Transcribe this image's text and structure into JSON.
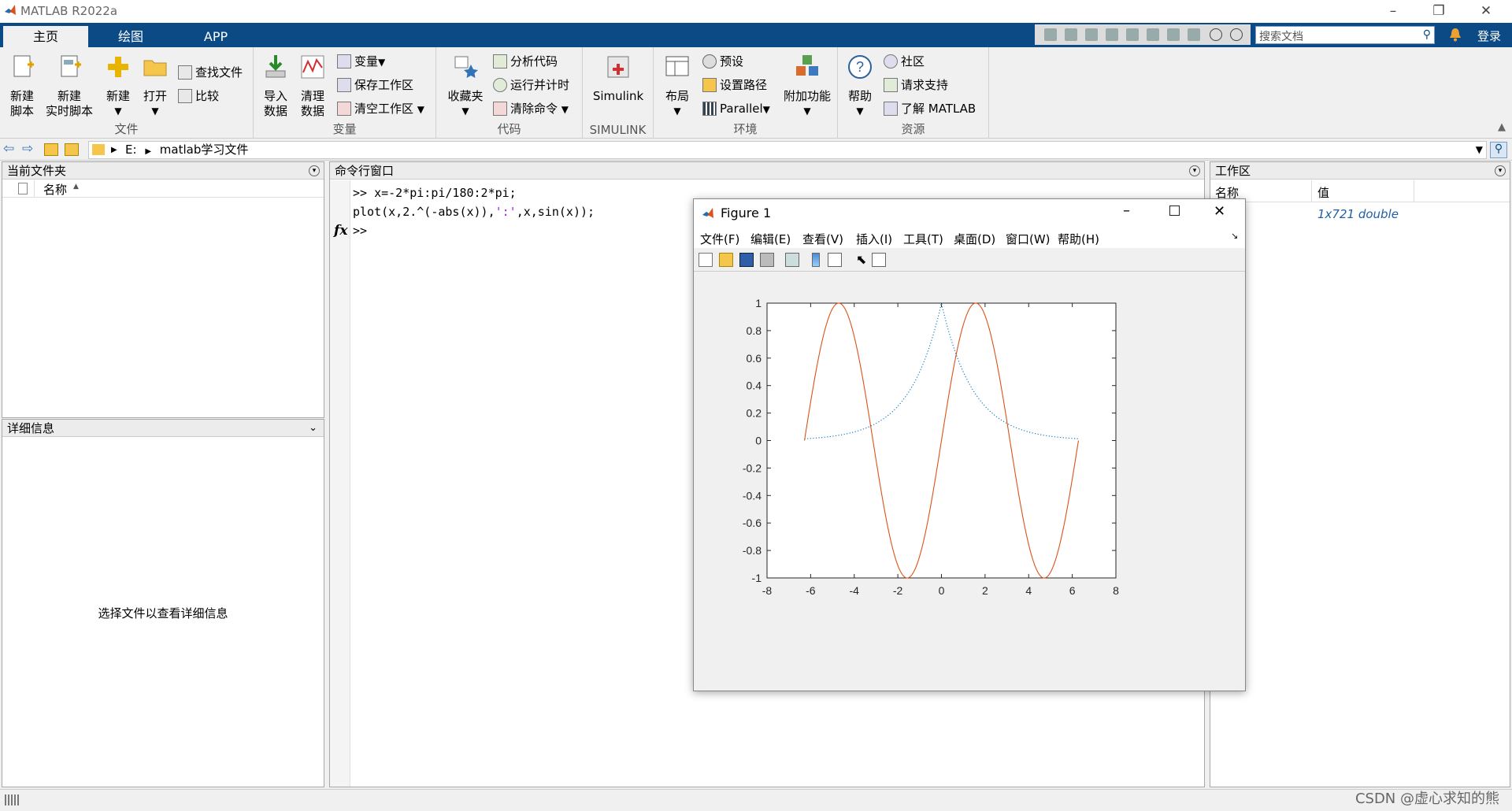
{
  "window": {
    "title": "MATLAB R2022a"
  },
  "tabs": [
    "主页",
    "绘图",
    "APP"
  ],
  "search": {
    "placeholder": "搜索文档"
  },
  "login": "登录",
  "ribbon": {
    "file": {
      "label": "文件",
      "new_script": [
        "新建",
        "脚本"
      ],
      "new_live_script": [
        "新建",
        "实时脚本"
      ],
      "new": "新建",
      "open": "打开",
      "find_files": "查找文件",
      "compare": "比较"
    },
    "variable": {
      "label": "变量",
      "import": [
        "导入",
        "数据"
      ],
      "clean": [
        "清理",
        "数据"
      ],
      "variable": "变量",
      "save_ws": "保存工作区",
      "clear_ws": "清空工作区"
    },
    "code": {
      "label": "代码",
      "favorites": "收藏夹",
      "analyze": "分析代码",
      "run_time": "运行并计时",
      "clear_cmd": "清除命令"
    },
    "simulink": {
      "label": "SIMULINK",
      "btn": "Simulink"
    },
    "env": {
      "label": "环境",
      "layout": "布局",
      "prefs": "预设",
      "set_path": "设置路径",
      "parallel": "Parallel",
      "addons": "附加功能"
    },
    "resources": {
      "label": "资源",
      "help": "帮助",
      "community": "社区",
      "request_support": "请求支持",
      "learn_matlab": "了解 MATLAB"
    }
  },
  "address": {
    "drive": "E:",
    "folder": "matlab学习文件"
  },
  "current_folder": {
    "title": "当前文件夹",
    "col_name": "名称"
  },
  "details": {
    "title": "详细信息",
    "message": "选择文件以查看详细信息"
  },
  "command_window": {
    "title": "命令行窗口",
    "line1": ">> x=-2*pi:pi/180:2*pi;",
    "line2_a": "plot(x,2.^(-abs(x)),",
    "line2_str": "':'",
    "line2_b": ",x,sin(x));",
    "fx": "fx",
    "prompt": ">>"
  },
  "workspace": {
    "title": "工作区",
    "col_name": "名称",
    "col_value": "值",
    "row_value": "1x721 double"
  },
  "figure": {
    "title": "Figure 1",
    "menu": [
      "文件(F)",
      "编辑(E)",
      "查看(V)",
      "插入(I)",
      "工具(T)",
      "桌面(D)",
      "窗口(W)",
      "帮助(H)"
    ]
  },
  "chart_data": {
    "type": "line",
    "xlim": [
      -8,
      8
    ],
    "ylim": [
      -1,
      1
    ],
    "xticks": [
      "-8",
      "-6",
      "-4",
      "-2",
      "0",
      "2",
      "4",
      "6",
      "8"
    ],
    "yticks": [
      "1",
      "0.8",
      "0.6",
      "0.4",
      "0.2",
      "0",
      "-0.2",
      "-0.4",
      "-0.6",
      "-0.8",
      "-1"
    ],
    "series": [
      {
        "formula": "2^(-abs(x))",
        "style": "dotted",
        "color": "#0072bd",
        "x_range": [
          -6.2832,
          6.2832
        ]
      },
      {
        "formula": "sin(x)",
        "style": "solid",
        "color": "#d95319",
        "x_range": [
          -6.2832,
          6.2832
        ]
      }
    ],
    "grid": false
  },
  "watermark": "CSDN @虚心求知的熊",
  "colors": {
    "tabbar": "#0c4a86",
    "accent": "#0c4a86"
  }
}
